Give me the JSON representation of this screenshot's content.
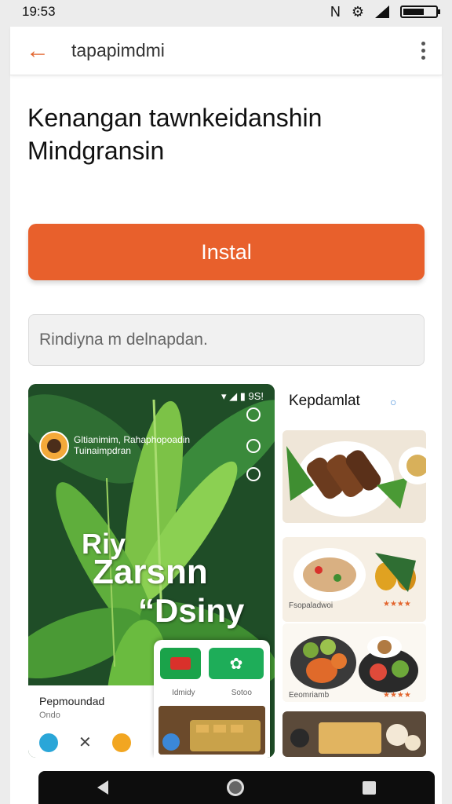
{
  "status_bar": {
    "time": "19:53",
    "icons": [
      "nfc-icon",
      "vibrate-icon",
      "signal-icon",
      "battery-icon"
    ]
  },
  "app_bar": {
    "title": "tapapimdmi"
  },
  "headline": {
    "line1": "Kenangan tawnkeidanshin",
    "line2": "Mindgransin"
  },
  "install_button": {
    "label": "Instal"
  },
  "search": {
    "value": "Rindiyna m delnapdan."
  },
  "screenshot_main": {
    "status": "▾ ◢ ▮ 9S!",
    "subtext": "Gltianimim, Rahaphopoadin\nTuinaimpdran",
    "big_text_1": "Riy",
    "big_text_2": "Zarsnn",
    "big_text_3": "“Dsiny",
    "bottom_title": "Pepmoundad",
    "bottom_sub": "Ondo",
    "inner_label_left": "Idmidy",
    "inner_label_right": "Sotoo"
  },
  "side_panel": {
    "title": "Kepdamlat",
    "food_label_1": "Fsopaladwoi",
    "food_label_2": "Eeomriamb",
    "stars": "★★★★"
  },
  "colors": {
    "accent": "#e8602c",
    "leaf_dark": "#1d4a24",
    "leaf_light": "#5fae3c"
  }
}
